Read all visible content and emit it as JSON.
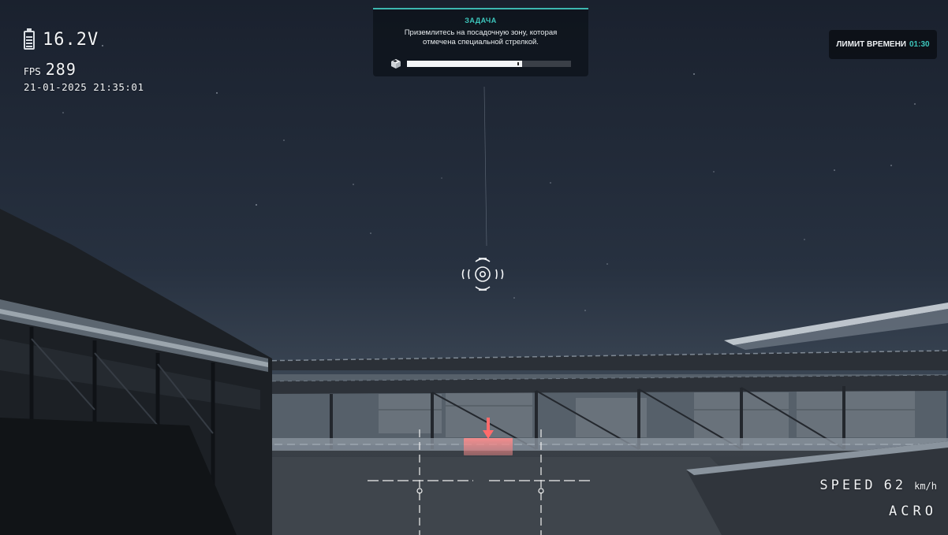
{
  "hud": {
    "battery": {
      "icon": "battery-icon",
      "voltage": "16.2V"
    },
    "fps": {
      "label": "FPS",
      "value": "289"
    },
    "datetime": "21-01-2025 21:35:01",
    "speed": {
      "label": "SPEED",
      "value": "62",
      "unit": "km/h"
    },
    "mode": "ACRO"
  },
  "task": {
    "title": "ЗАДАЧА",
    "text": "Приземлитесь на посадочную зону, которая отмечена специальной стрелкой.",
    "icon": "drone-box-icon",
    "progress": 0.7
  },
  "time_limit": {
    "label": "ЛИМИТ ВРЕМЕНИ",
    "value": "01:30"
  },
  "crosshair": {
    "icon": "target-reticle-icon"
  },
  "landing_marker": {
    "icon": "arrow-down-icon",
    "color": "#ff6b6b"
  },
  "colors": {
    "accent": "#3dc7bd",
    "sky_top": "#1b2230",
    "sky_bottom": "#3a4553"
  }
}
